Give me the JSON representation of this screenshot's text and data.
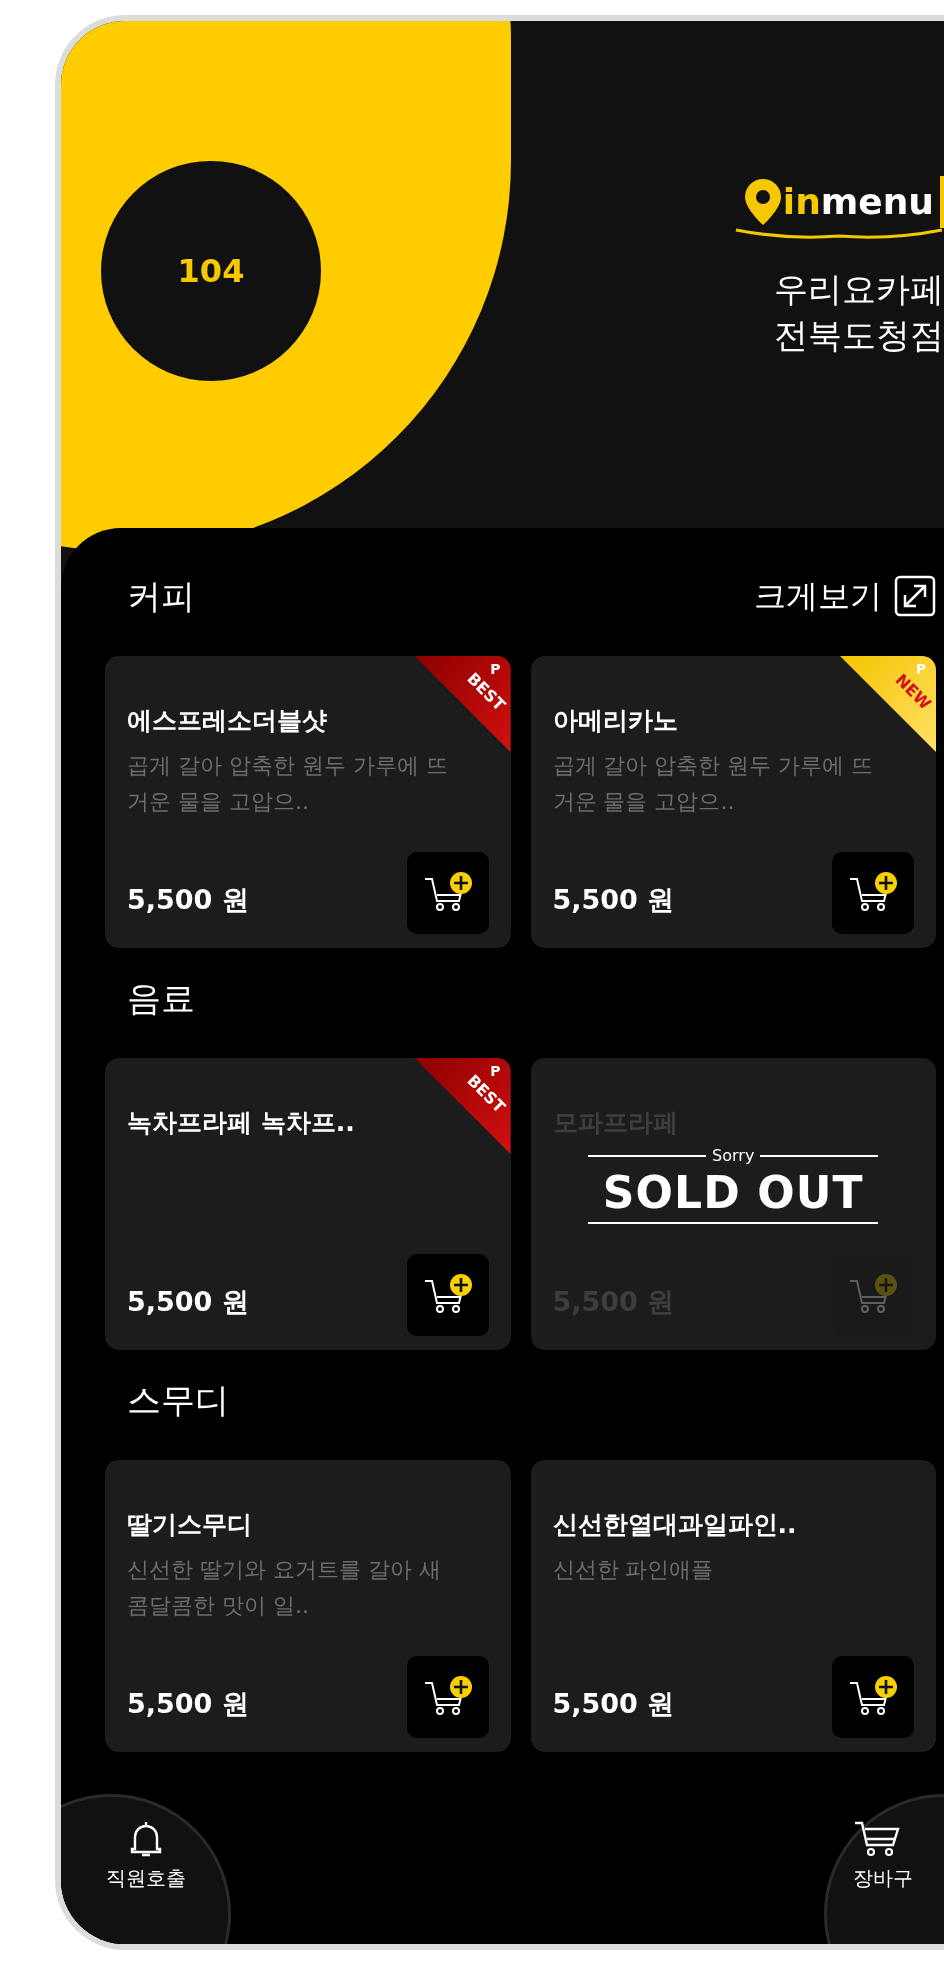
{
  "table_badge": "104",
  "logo": {
    "accent": "in",
    "text": "menu"
  },
  "store": {
    "name": "우리요카페",
    "branch": "전북도청점"
  },
  "enlarge_link": "크게보기",
  "sections": [
    {
      "title": "커피",
      "items": [
        {
          "name": "에스프레소더블샷",
          "description": "곱게 갈아 압축한 원두 가루에 뜨거운 물을 고압으..",
          "price": "5,500 원",
          "sold_out": false,
          "badge": {
            "kind": "best",
            "mark": "P",
            "text": "BEST"
          }
        },
        {
          "name": "아메리카노",
          "description": "곱게 갈아 압축한 원두 가루에 뜨거운 물을 고압으..",
          "price": "5,500 원",
          "sold_out": false,
          "badge": {
            "kind": "new",
            "mark": "P",
            "text": "NEW"
          }
        }
      ]
    },
    {
      "title": "음료",
      "items": [
        {
          "name": "녹차프라페 녹차프..",
          "price": "5,500 원",
          "sold_out": false,
          "badge": {
            "kind": "best",
            "mark": "P",
            "text": "BEST"
          }
        },
        {
          "name": "모파프라페",
          "price": "5,500 원",
          "sold_out": true,
          "sold_out_note": "Sorry",
          "sold_out_label": "SOLD OUT"
        }
      ]
    },
    {
      "title": "스무디",
      "items": [
        {
          "name": "딸기스무디",
          "description": "신선한 딸기와 요거트를 갈아 새콤달콤한 맛이 일..",
          "price": "5,500 원",
          "sold_out": false
        },
        {
          "name": "신선한열대과일파인..",
          "description": "신선한 파인애플",
          "price": "5,500 원",
          "sold_out": false
        }
      ]
    }
  ],
  "bottom_buttons": {
    "call": "직원호출",
    "cart": "장바구"
  }
}
